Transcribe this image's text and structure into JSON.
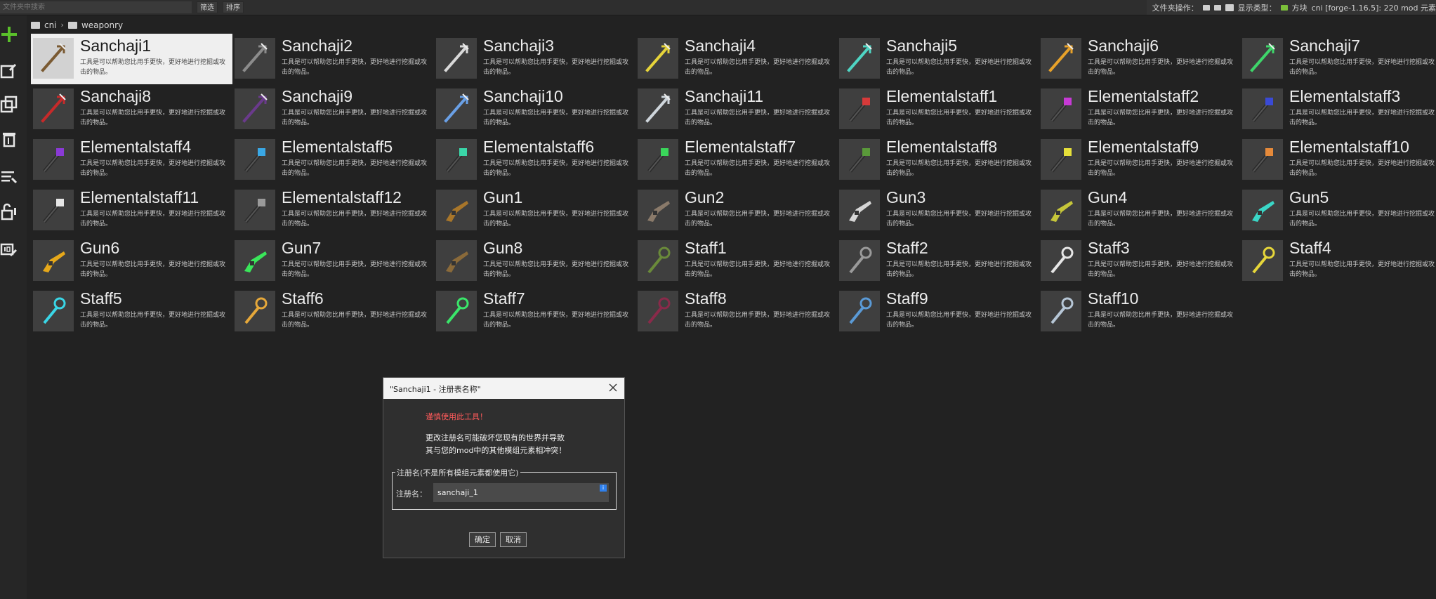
{
  "toolbar": {
    "search_placeholder": "文件夹中搜索",
    "filter_label": "筛选",
    "sort_label": "排序",
    "folder_ops_label": "文件夹操作：",
    "display_type_label": "显示类型：",
    "display_type_value": "方块",
    "workspace_label": "cni [forge-1.16.5]: 220 mod 元素"
  },
  "breadcrumb": {
    "root": "cni",
    "folder": "weaponry"
  },
  "item_description": "工具是可以帮助您比用手更快，更好地进行挖掘或攻击的物品。",
  "items": [
    {
      "name": "Sanchaji1",
      "icon": "trident-icon",
      "color": "#7a5a32"
    },
    {
      "name": "Sanchaji2",
      "icon": "trident-icon",
      "color": "#8c8c8c"
    },
    {
      "name": "Sanchaji3",
      "icon": "trident-icon",
      "color": "#d9d9d9"
    },
    {
      "name": "Sanchaji4",
      "icon": "trident-icon",
      "color": "#e6d43a"
    },
    {
      "name": "Sanchaji5",
      "icon": "trident-icon",
      "color": "#4fd6c4"
    },
    {
      "name": "Sanchaji6",
      "icon": "trident-icon",
      "color": "#e8a22a"
    },
    {
      "name": "Sanchaji7",
      "icon": "trident-icon",
      "color": "#3ed66a"
    },
    {
      "name": "Sanchaji8",
      "icon": "trident-icon",
      "color": "#c62a2a"
    },
    {
      "name": "Sanchaji9",
      "icon": "trident-icon",
      "color": "#6a3a8c"
    },
    {
      "name": "Sanchaji10",
      "icon": "trident-icon",
      "color": "#6aa0e6"
    },
    {
      "name": "Sanchaji11",
      "icon": "trident-icon",
      "color": "#cfd6dc"
    },
    {
      "name": "Elementalstaff1",
      "icon": "staff-icon",
      "color": "#d63a3a"
    },
    {
      "name": "Elementalstaff2",
      "icon": "staff-icon",
      "color": "#c73ad6"
    },
    {
      "name": "Elementalstaff3",
      "icon": "staff-icon",
      "color": "#3a4ad6"
    },
    {
      "name": "Elementalstaff4",
      "icon": "staff-icon",
      "color": "#8a3ad6"
    },
    {
      "name": "Elementalstaff5",
      "icon": "staff-icon",
      "color": "#3aa8e6"
    },
    {
      "name": "Elementalstaff6",
      "icon": "staff-icon",
      "color": "#3ad6a8"
    },
    {
      "name": "Elementalstaff7",
      "icon": "staff-icon",
      "color": "#3ad65a"
    },
    {
      "name": "Elementalstaff8",
      "icon": "staff-icon",
      "color": "#5a9a3a"
    },
    {
      "name": "Elementalstaff9",
      "icon": "staff-icon",
      "color": "#e6e03a"
    },
    {
      "name": "Elementalstaff10",
      "icon": "staff-icon",
      "color": "#e68a3a"
    },
    {
      "name": "Elementalstaff11",
      "icon": "staff-icon",
      "color": "#e6e6e6"
    },
    {
      "name": "Elementalstaff12",
      "icon": "staff-icon",
      "color": "#9a9a9a"
    },
    {
      "name": "Gun1",
      "icon": "gun-icon",
      "color": "#a8762a"
    },
    {
      "name": "Gun2",
      "icon": "gun-icon",
      "color": "#8a7a6a"
    },
    {
      "name": "Gun3",
      "icon": "gun-icon",
      "color": "#d6d6d6"
    },
    {
      "name": "Gun4",
      "icon": "gun-icon",
      "color": "#c6c63a"
    },
    {
      "name": "Gun5",
      "icon": "gun-icon",
      "color": "#3ad6c6"
    },
    {
      "name": "Gun6",
      "icon": "gun-icon",
      "color": "#e6a81a"
    },
    {
      "name": "Gun7",
      "icon": "gun-icon",
      "color": "#3ae65a"
    },
    {
      "name": "Gun8",
      "icon": "gun-icon",
      "color": "#8a6a3a"
    },
    {
      "name": "Staff1",
      "icon": "wand-icon",
      "color": "#6a8a3a"
    },
    {
      "name": "Staff2",
      "icon": "wand-icon",
      "color": "#9a9a9a"
    },
    {
      "name": "Staff3",
      "icon": "wand-icon",
      "color": "#e6e6e6"
    },
    {
      "name": "Staff4",
      "icon": "wand-icon",
      "color": "#e6d63a"
    },
    {
      "name": "Staff5",
      "icon": "wand-icon",
      "color": "#3ad6e6"
    },
    {
      "name": "Staff6",
      "icon": "wand-icon",
      "color": "#e6a83a"
    },
    {
      "name": "Staff7",
      "icon": "wand-icon",
      "color": "#3ae66a"
    },
    {
      "name": "Staff8",
      "icon": "wand-icon",
      "color": "#8a2a4a"
    },
    {
      "name": "Staff9",
      "icon": "wand-icon",
      "color": "#5a9ad6"
    },
    {
      "name": "Staff10",
      "icon": "wand-icon",
      "color": "#b6c6d6"
    }
  ],
  "dialog": {
    "title": "\"Sanchaji1 - 注册表名称\"",
    "warning": "谨慎使用此工具！",
    "message_line1": "更改注册名可能破坏您现有的世界并导致",
    "message_line2": "其与您的mod中的其他模组元素相冲突！",
    "group_label": "注册名(不是所有模组元素都使用它)",
    "field_label": "注册名：",
    "field_value": "sanchaji_1",
    "info_badge": "i",
    "ok_label": "确定",
    "cancel_label": "取消"
  },
  "colors": {
    "accent_add": "#5ac02a",
    "warning": "#ff5a5a",
    "selection": "#efefef"
  }
}
